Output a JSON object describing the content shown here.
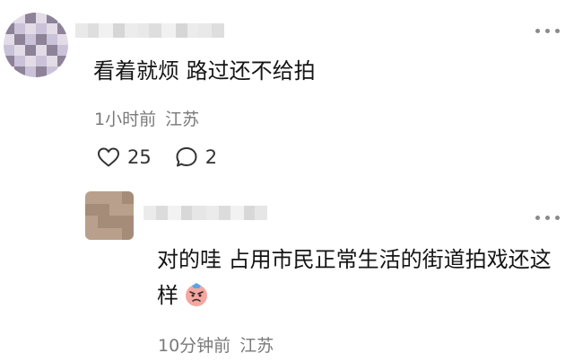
{
  "comments": [
    {
      "text": "看着就烦 路过还不给拍",
      "time": "1小时前",
      "location": "江苏",
      "likes": "25",
      "replies": "2"
    },
    {
      "text": "对的哇 占用市民正常生活的街道拍戏还这样",
      "time": "10分钟前",
      "location": "江苏",
      "emoji": "angry-face-emoji"
    }
  ],
  "icons": {
    "like": "heart-outline-icon",
    "reply": "speech-bubble-icon",
    "more": "more-dots-icon"
  },
  "colors": {
    "text": "#151515",
    "meta": "#7a7a7a",
    "background": "#ffffff"
  }
}
